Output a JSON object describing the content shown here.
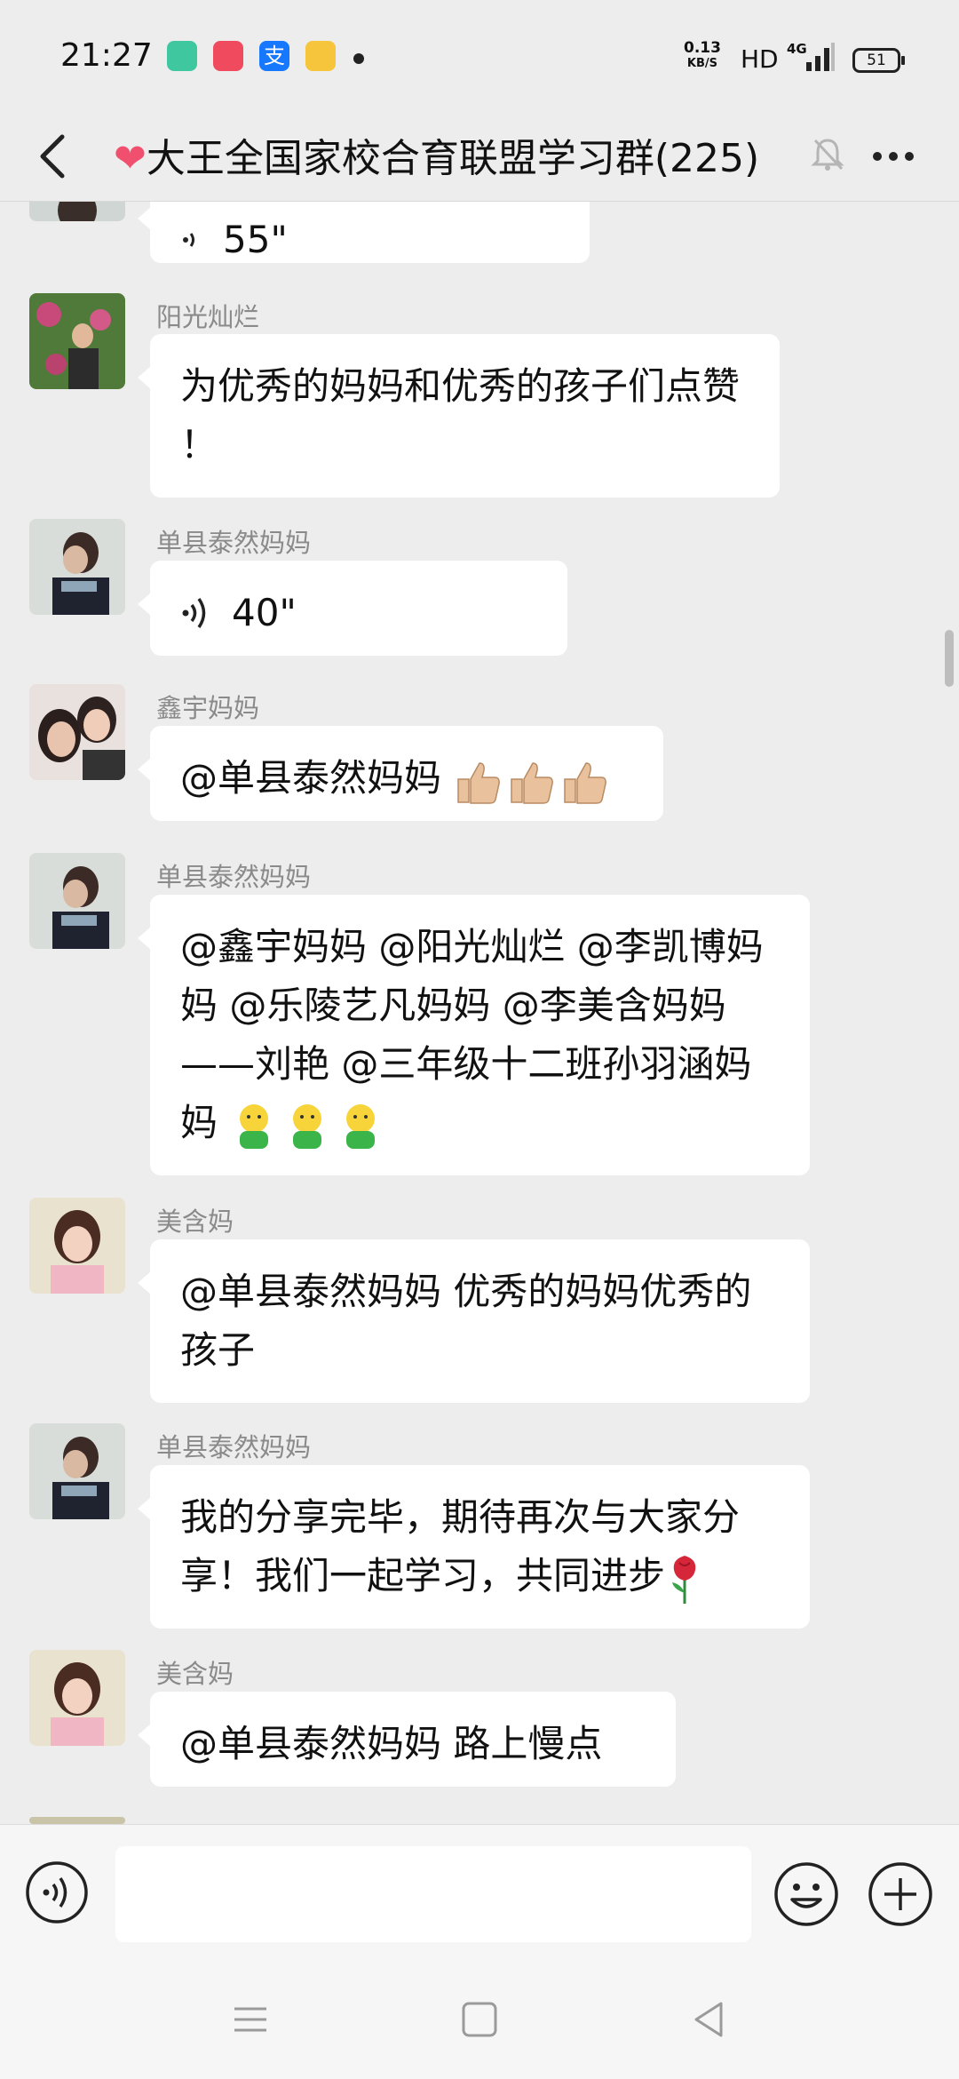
{
  "status_bar": {
    "time": "21:27",
    "net_speed_value": "0.13",
    "net_speed_unit": "KB/S",
    "hd_label": "HD",
    "network": "4G",
    "battery": "51"
  },
  "header": {
    "heart": "❤",
    "title": "大王全国家校合育联盟学习群(225)"
  },
  "messages": [
    {
      "id": "m0",
      "type": "voice",
      "duration": "55\""
    },
    {
      "id": "m1",
      "sender": "阳光灿烂",
      "text": "为优秀的妈妈和优秀的孩子们点赞 ！"
    },
    {
      "id": "m2",
      "sender": "单县泰然妈妈",
      "type": "voice",
      "duration": "40\""
    },
    {
      "id": "m3",
      "sender": "鑫宇妈妈",
      "text": "@单县泰然妈妈 ",
      "emoji": "thumbs-up-icon x3"
    },
    {
      "id": "m4",
      "sender": "单县泰然妈妈",
      "text": "@鑫宇妈妈 @阳光灿烂 @李凯博妈妈 @乐陵艺凡妈妈 @李美含妈妈——刘艳 @三年级十二班孙羽涵妈妈 ",
      "emoji": "hug-icon x3"
    },
    {
      "id": "m5",
      "sender": "美含妈",
      "text": "@单县泰然妈妈  优秀的妈妈优秀的孩子"
    },
    {
      "id": "m6",
      "sender": "单县泰然妈妈",
      "text": "我的分享完毕，期待再次与大家分享！我们一起学习，共同进步",
      "emoji": "rose-icon"
    },
    {
      "id": "m7",
      "sender": "美含妈",
      "text": "@单县泰然妈妈  路上慢点"
    }
  ],
  "colors": {
    "background": "#ededed",
    "bubble": "#ffffff",
    "name_text": "#8a8a8a",
    "heart": "#f0506e"
  }
}
